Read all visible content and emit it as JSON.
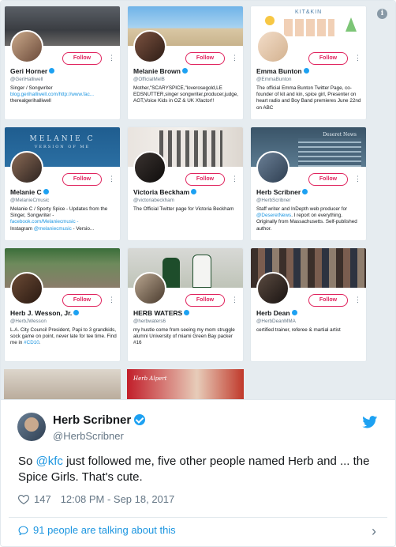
{
  "screenshot": {
    "cards": [
      {
        "name": "Geri Horner",
        "verified": true,
        "handle": "@GeriHalliwell",
        "follow_label": "Follow",
        "bio": "Singer / Songwriter",
        "link": "blog.gerihalliwell.com/http://www.fac...",
        "bio_tail": "therealgerihalliwell"
      },
      {
        "name": "Melanie Brown",
        "verified": true,
        "handle": "@OfficialMelB",
        "follow_label": "Follow",
        "bio": "Mother,\"SCARYSPICE,\"loverosegold,LE EDSNUTTER,singer songwriter,producer,judge, AGT,Voice Kids in OZ & UK Xfactor!!"
      },
      {
        "name": "Emma Bunton",
        "verified": true,
        "handle": "@EmmaBunton",
        "follow_label": "Follow",
        "banner_text": "KIT&KIN",
        "bio": "The official Emma Bunton Twitter Page, co-founder of kit and kin, spice girl, Presenter on heart radio and Boy Band premieres June 22nd on ABC"
      },
      {
        "name": "Melanie C",
        "verified": true,
        "handle": "@MelanieCmusic",
        "follow_label": "Follow",
        "banner_text": "MELANIE C",
        "banner_sub": "VERSION OF ME",
        "bio": "Melanie C / Sporty Spice - Updates from the Singer, Songwriter -",
        "link": "facebook.com/Melaniecmusic -",
        "bio_tail_prefix": "Instagram ",
        "link2": "@melaniecmusic",
        "bio_tail": " - Versio..."
      },
      {
        "name": "Victoria Beckham",
        "verified": true,
        "handle": "@victoriabeckham",
        "follow_label": "Follow",
        "bio": "The Official Twitter page for Victoria Beckham"
      },
      {
        "name": "Herb Scribner",
        "verified": true,
        "handle": "@HerbScribner",
        "follow_label": "Follow",
        "banner_text": "Deseret News",
        "bio": "Staff writer and InDepth web producer for ",
        "link": "@DeseretNews",
        "bio_tail": ". I report on everything. Originally from Massachusetts. Self-published author."
      },
      {
        "name": "Herb J. Wesson, Jr.",
        "verified": true,
        "handle": "@HerbJWesson",
        "follow_label": "Follow",
        "bio": "L.A. City Council President, Papi to 3 grandkids, sock game on point, never late for tee time. Find me in ",
        "link": "#CD10",
        "bio_tail": "."
      },
      {
        "name": "HERB WATERS",
        "verified": true,
        "handle": "@herbwaters6",
        "follow_label": "Follow",
        "bio": "my hustle come from seeing my mom struggle alumni University of miami Green Bay packer #16"
      },
      {
        "name": "Herb Dean",
        "verified": true,
        "handle": "@HerbDeanMMA",
        "follow_label": "Follow",
        "bio": "certified trainer, referee & martial artist"
      }
    ],
    "partial_banner_text": "Herb Alpert"
  },
  "tweet": {
    "author_name": "Herb Scribner",
    "author_handle": "@HerbScribner",
    "text_prefix": "So ",
    "mention": "@kfc",
    "text_suffix": " just followed me, five other people named Herb and ... the Spice Girls. That's cute.",
    "likes": "147",
    "timestamp": "12:08 PM - Sep 18, 2017",
    "talking": "91 people are talking about this"
  },
  "colors": {
    "twitter_blue": "#1da1f2",
    "follow_red": "#e0245e",
    "link_blue": "#1b95e0",
    "muted": "#657786"
  }
}
